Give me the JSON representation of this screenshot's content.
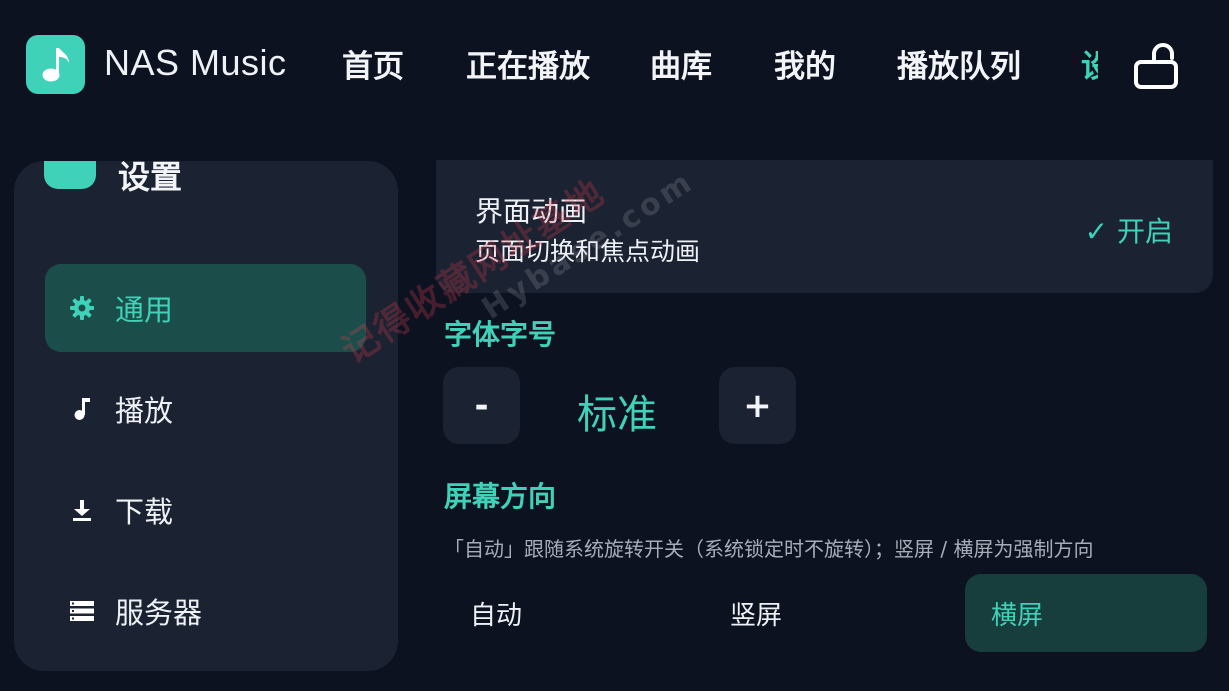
{
  "app": {
    "name": "NAS Music"
  },
  "colors": {
    "accent": "#3fd2b8",
    "background": "#0d1220",
    "card": "#1b2231",
    "active_bg": "#1b4e4a"
  },
  "nav": {
    "items": [
      {
        "label": "首页"
      },
      {
        "label": "正在播放"
      },
      {
        "label": "曲库"
      },
      {
        "label": "我的"
      },
      {
        "label": "播放队列"
      },
      {
        "label": "设置",
        "active": true
      }
    ],
    "lock_icon": "lock-open-icon"
  },
  "sidebar": {
    "title": "设置",
    "items": [
      {
        "label": "通用",
        "icon": "gear-icon",
        "active": true
      },
      {
        "label": "播放",
        "icon": "music-note-icon"
      },
      {
        "label": "下载",
        "icon": "download-icon"
      },
      {
        "label": "服务器",
        "icon": "server-icon"
      }
    ]
  },
  "settings": {
    "animation": {
      "title": "界面动画",
      "description": "页面切换和焦点动画",
      "status": "✓ 开启"
    },
    "font_size": {
      "title": "字体字号",
      "decrease": "-",
      "value": "标准",
      "increase": "+"
    },
    "orientation": {
      "title": "屏幕方向",
      "description": "「自动」跟随系统旋转开关（系统锁定时不旋转）；竖屏 / 横屏为强制方向",
      "options": [
        "自动",
        "竖屏",
        "横屏"
      ],
      "selected": "横屏"
    }
  },
  "watermark": {
    "line1": "记得收藏网址基地",
    "line2": "Hybase.com"
  }
}
